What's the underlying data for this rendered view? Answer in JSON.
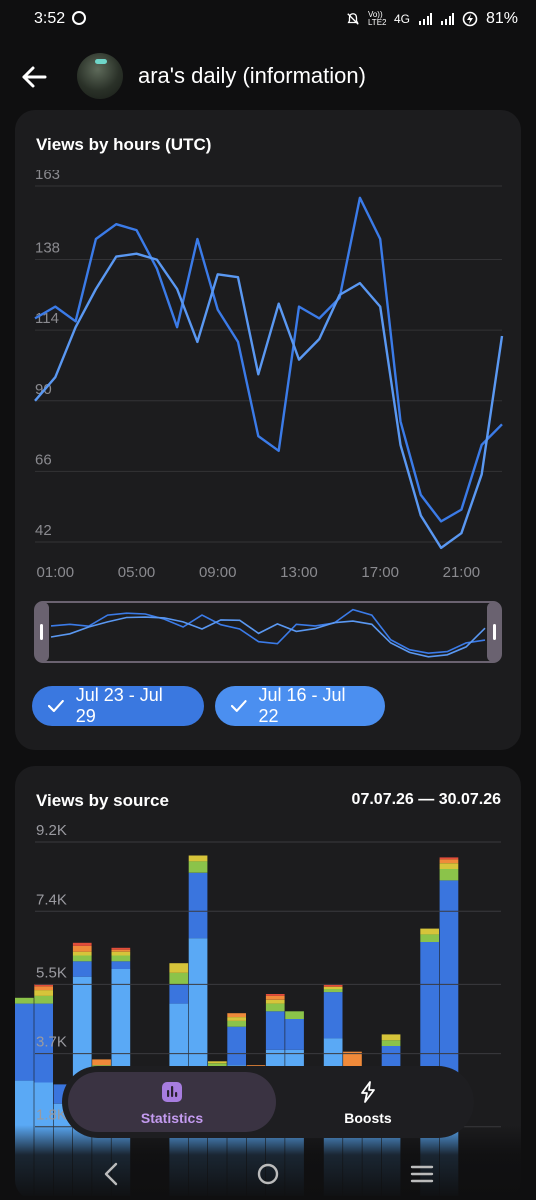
{
  "status_bar": {
    "time": "3:52",
    "net": "4G",
    "volte": "Vo)) LTE2",
    "battery": "81%"
  },
  "header": {
    "title": "ara's daily (information)"
  },
  "hours_chart": {
    "title": "Views by hours (UTC)",
    "chips": [
      {
        "label": "Jul 23 - Jul 29",
        "color": "#3a78e0"
      },
      {
        "label": "Jul 16 - Jul 22",
        "color": "#4b8ff0"
      }
    ]
  },
  "source_chart": {
    "title": "Views by source",
    "range": "07.07.26 — 30.07.26"
  },
  "bottom_nav": {
    "items": [
      {
        "label": "Statistics",
        "icon": "bar-chart-icon",
        "active": true
      },
      {
        "label": "Boosts",
        "icon": "lightning-icon",
        "active": false
      }
    ]
  },
  "chart_data": [
    {
      "type": "line",
      "title": "Views by hours (UTC)",
      "xlabel": "",
      "ylabel": "",
      "x": [
        0,
        1,
        2,
        3,
        4,
        5,
        6,
        7,
        8,
        9,
        10,
        11,
        12,
        13,
        14,
        15,
        16,
        17,
        18,
        19,
        20,
        21,
        22,
        23
      ],
      "x_tick_labels": [
        "01:00",
        "05:00",
        "09:00",
        "13:00",
        "17:00",
        "21:00"
      ],
      "x_tick_positions": [
        1,
        5,
        9,
        13,
        17,
        21
      ],
      "y_ticks": [
        163,
        138,
        114,
        90,
        66,
        42
      ],
      "ylim": [
        42,
        163
      ],
      "grid": true,
      "series": [
        {
          "name": "Jul 23 - Jul 29",
          "color": "#3b7be8",
          "values": [
            118,
            122,
            117,
            145,
            150,
            148,
            135,
            115,
            145,
            121,
            110,
            78,
            73,
            122,
            118,
            125,
            159,
            145,
            83,
            58,
            49,
            53,
            75,
            82
          ]
        },
        {
          "name": "Jul 16 - Jul 22",
          "color": "#5a98f2",
          "values": [
            90,
            98,
            115,
            128,
            139,
            140,
            138,
            128,
            110,
            133,
            132,
            99,
            123,
            104,
            111,
            126,
            130,
            122,
            75,
            51,
            40,
            45,
            65,
            112
          ]
        }
      ]
    },
    {
      "type": "bar",
      "stacked": true,
      "title": "Views by source",
      "date_range": "07.07.26 — 30.07.26",
      "y_ticks": [
        "9.2K",
        "7.4K",
        "5.5K",
        "3.7K",
        "1.8K"
      ],
      "ylim": [
        0,
        9200
      ],
      "grid": true,
      "series_colors": {
        "light_blue": "#5aa9f5",
        "blue": "#3a75de",
        "green": "#8bc34a",
        "yellow": "#d6c43a",
        "orange": "#f08a3a",
        "red": "#e24d3a"
      },
      "bars": [
        {
          "light_blue": 3000,
          "blue": 2000,
          "green": 150,
          "yellow": 0,
          "orange": 0,
          "red": 0,
          "partial": true
        },
        {
          "light_blue": 2950,
          "blue": 2050,
          "green": 200,
          "yellow": 150,
          "orange": 100,
          "red": 50
        },
        {
          "light_blue": 2400,
          "blue": 500,
          "green": 0,
          "yellow": 0,
          "orange": 0,
          "red": 0
        },
        {
          "light_blue": 5700,
          "blue": 400,
          "green": 150,
          "yellow": 100,
          "orange": 150,
          "red": 80
        },
        {
          "light_blue": 3100,
          "blue": 200,
          "green": 100,
          "yellow": 0,
          "orange": 150,
          "red": 0
        },
        {
          "light_blue": 5900,
          "blue": 200,
          "green": 150,
          "yellow": 100,
          "orange": 50,
          "red": 50
        },
        {
          "light_blue": 0,
          "blue": 0,
          "green": 0,
          "yellow": 0,
          "orange": 0,
          "red": 0
        },
        {
          "light_blue": 0,
          "blue": 0,
          "green": 0,
          "yellow": 0,
          "orange": 0,
          "red": 0
        },
        {
          "light_blue": 5000,
          "blue": 500,
          "green": 300,
          "yellow": 250,
          "orange": 0,
          "red": 0
        },
        {
          "light_blue": 6700,
          "blue": 1700,
          "green": 300,
          "yellow": 150,
          "orange": 0,
          "red": 0
        },
        {
          "light_blue": 3000,
          "blue": 300,
          "green": 150,
          "yellow": 50,
          "orange": 0,
          "red": 0
        },
        {
          "light_blue": 3400,
          "blue": 1000,
          "green": 150,
          "yellow": 100,
          "orange": 100,
          "red": 0
        },
        {
          "light_blue": 2900,
          "blue": 250,
          "green": 100,
          "yellow": 50,
          "orange": 100,
          "red": 0
        },
        {
          "light_blue": 3800,
          "blue": 1000,
          "green": 200,
          "yellow": 100,
          "orange": 100,
          "red": 50
        },
        {
          "light_blue": 3800,
          "blue": 800,
          "green": 200,
          "yellow": 0,
          "orange": 0,
          "red": 0
        },
        {
          "light_blue": 0,
          "blue": 0,
          "green": 0,
          "yellow": 0,
          "orange": 0,
          "red": 0
        },
        {
          "light_blue": 4100,
          "blue": 1200,
          "green": 80,
          "yellow": 60,
          "orange": 0,
          "red": 50
        },
        {
          "light_blue": 2700,
          "blue": 400,
          "green": 100,
          "yellow": 50,
          "orange": 500,
          "red": 0
        },
        {
          "light_blue": 2700,
          "blue": 200,
          "green": 100,
          "yellow": 50,
          "orange": 150,
          "red": 0
        },
        {
          "light_blue": 3200,
          "blue": 700,
          "green": 150,
          "yellow": 150,
          "orange": 0,
          "red": 0
        },
        {
          "light_blue": 0,
          "blue": 0,
          "green": 0,
          "yellow": 0,
          "orange": 0,
          "red": 0
        },
        {
          "light_blue": 3000,
          "blue": 3600,
          "green": 200,
          "yellow": 150,
          "orange": 0,
          "red": 0
        },
        {
          "light_blue": 3200,
          "blue": 5000,
          "green": 300,
          "yellow": 150,
          "orange": 100,
          "red": 50
        },
        {
          "light_blue": 0,
          "blue": 0,
          "green": 0,
          "yellow": 0,
          "orange": 0,
          "red": 0
        }
      ]
    }
  ]
}
